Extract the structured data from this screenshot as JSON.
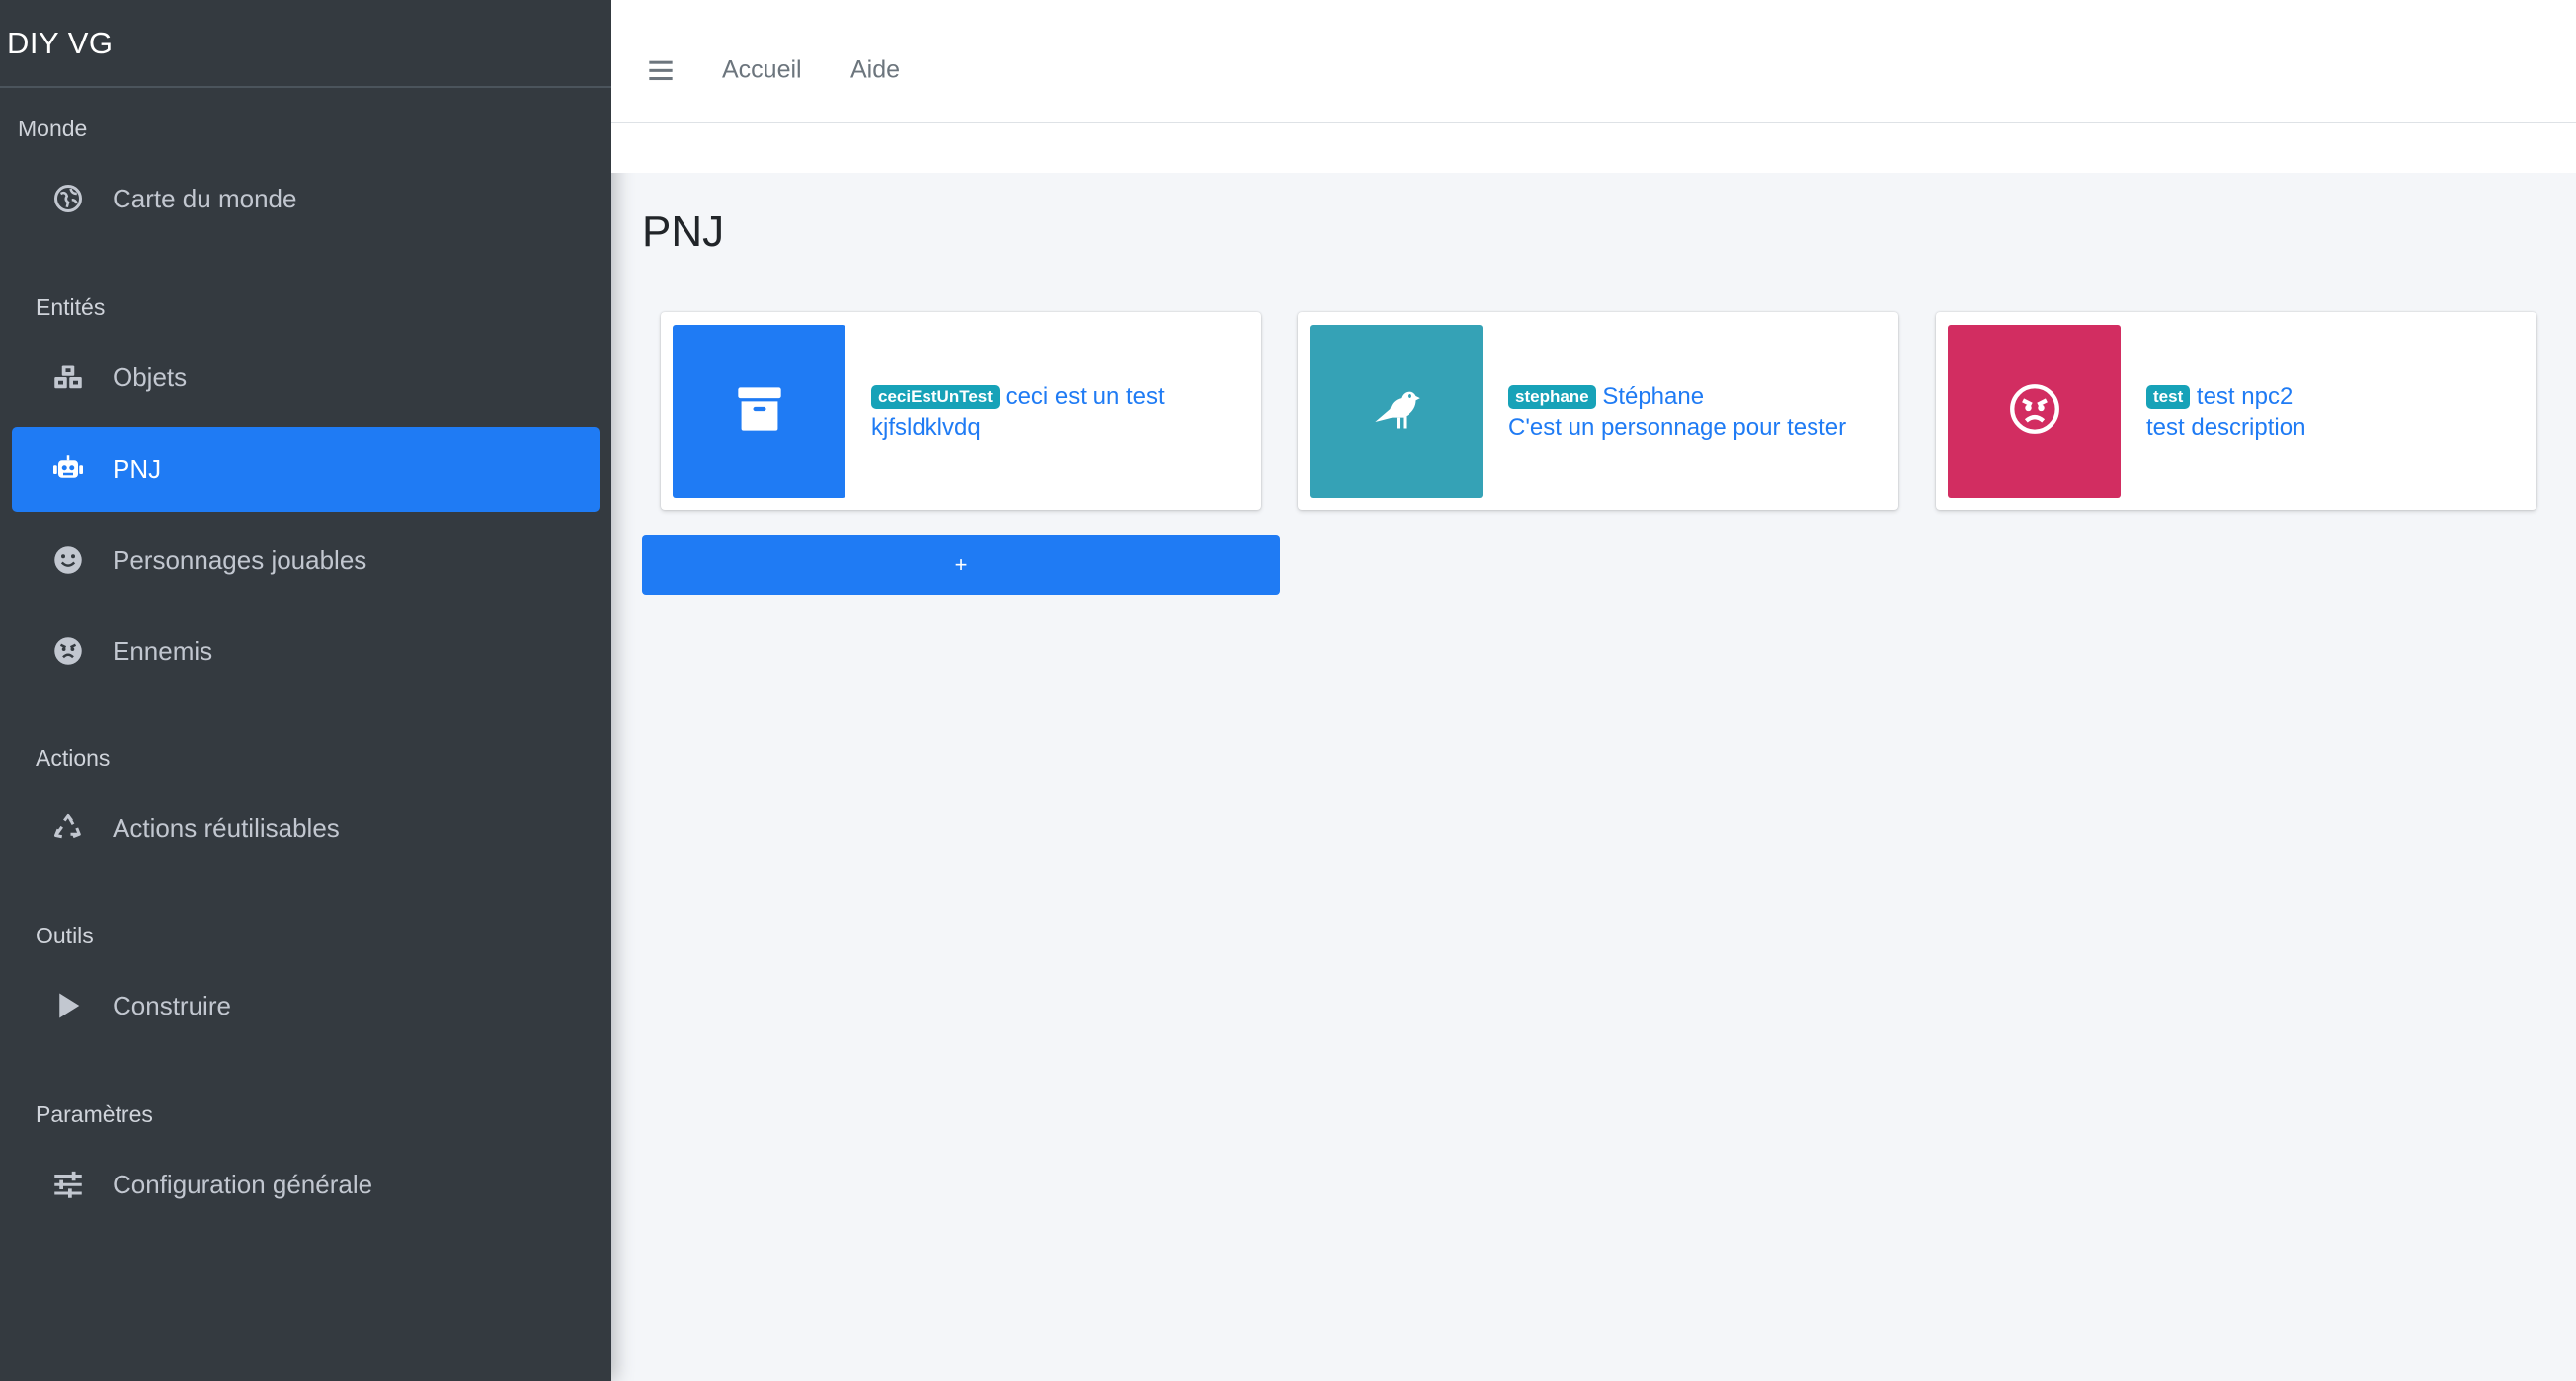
{
  "brand": "DIY VG",
  "sidebar": {
    "sections": [
      {
        "header": "Monde",
        "items": [
          {
            "label": "Carte du monde",
            "icon": "globe-icon"
          }
        ]
      },
      {
        "header": "Entités",
        "items": [
          {
            "label": "Objets",
            "icon": "cubes-icon"
          },
          {
            "label": "PNJ",
            "icon": "robot-icon",
            "active": true
          },
          {
            "label": "Personnages jouables",
            "icon": "smile-icon"
          },
          {
            "label": "Ennemis",
            "icon": "angry-face-icon"
          }
        ]
      },
      {
        "header": "Actions",
        "items": [
          {
            "label": "Actions réutilisables",
            "icon": "recycle-icon"
          }
        ]
      },
      {
        "header": "Outils",
        "items": [
          {
            "label": "Construire",
            "icon": "play-icon"
          }
        ]
      },
      {
        "header": "Paramètres",
        "items": [
          {
            "label": "Configuration générale",
            "icon": "sliders-icon"
          }
        ]
      }
    ]
  },
  "topbar": {
    "links": [
      "Accueil",
      "Aide"
    ]
  },
  "page": {
    "title": "PNJ"
  },
  "cards": [
    {
      "badge": "ceciEstUnTest",
      "name": "ceci est un test",
      "description": "kjfsldklvdq",
      "icon": "archive-box-icon",
      "color": "#1f7bf4"
    },
    {
      "badge": "stephane",
      "name": "Stéphane",
      "description": "C'est un personnage pour tester",
      "icon": "crow-icon",
      "color": "#35a2b6"
    },
    {
      "badge": "test",
      "name": "test npc2",
      "description": "test description",
      "icon": "angry-face-icon",
      "color": "#d22d61"
    }
  ],
  "add_button": "+",
  "colors": {
    "sidebar_bg": "#343a40",
    "accent": "#1f7bf4",
    "badge": "#17a2b8",
    "content_bg": "#f4f6f9"
  }
}
